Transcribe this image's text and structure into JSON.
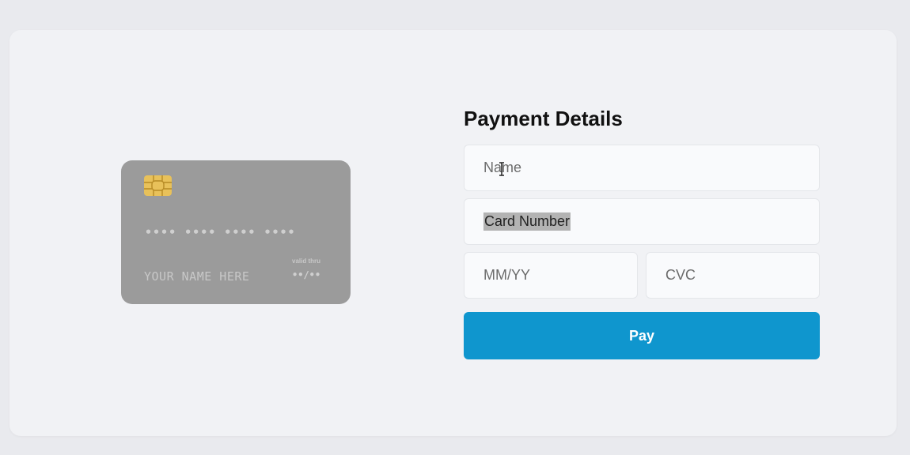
{
  "form": {
    "title": "Payment Details",
    "name_placeholder": "Name",
    "card_number_placeholder": "Card Number",
    "expiry_placeholder": "MM/YY",
    "cvc_placeholder": "CVC",
    "pay_label": "Pay"
  },
  "card": {
    "number": "•••• •••• •••• ••••",
    "holder": "YOUR NAME HERE",
    "valid_label": "valid thru",
    "expiry": "••/••",
    "chip_icon": "chip-icon"
  },
  "colors": {
    "accent": "#0f96ce",
    "card_bg": "#9b9b9b",
    "chip": "#e8c15a"
  }
}
